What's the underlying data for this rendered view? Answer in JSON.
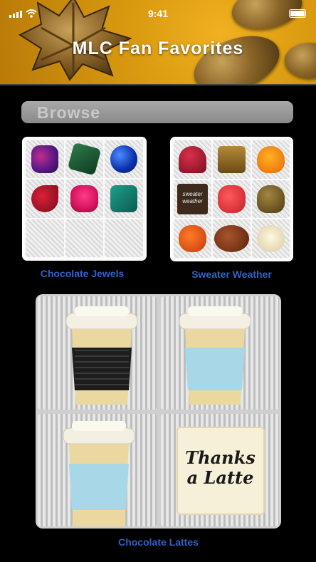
{
  "status_bar": {
    "time": "9:41"
  },
  "header": {
    "title": "MLC Fan Favorites"
  },
  "browse": {
    "label": "Browse"
  },
  "products": [
    {
      "name": "Chocolate Jewels"
    },
    {
      "name": "Sweater Weather"
    },
    {
      "name": "Chocolate Lattes"
    }
  ],
  "sweater_piece_text": [
    "sweater",
    "weather"
  ],
  "latte_square_text": [
    "Thanks",
    "a Latte"
  ],
  "colors": {
    "header_gold": "#d99a10",
    "link_blue": "#2f63c8",
    "background": "#000000",
    "browse_bar": "#9a9a9a"
  },
  "icons": [
    "signal-icon",
    "wifi-icon",
    "battery-icon"
  ]
}
